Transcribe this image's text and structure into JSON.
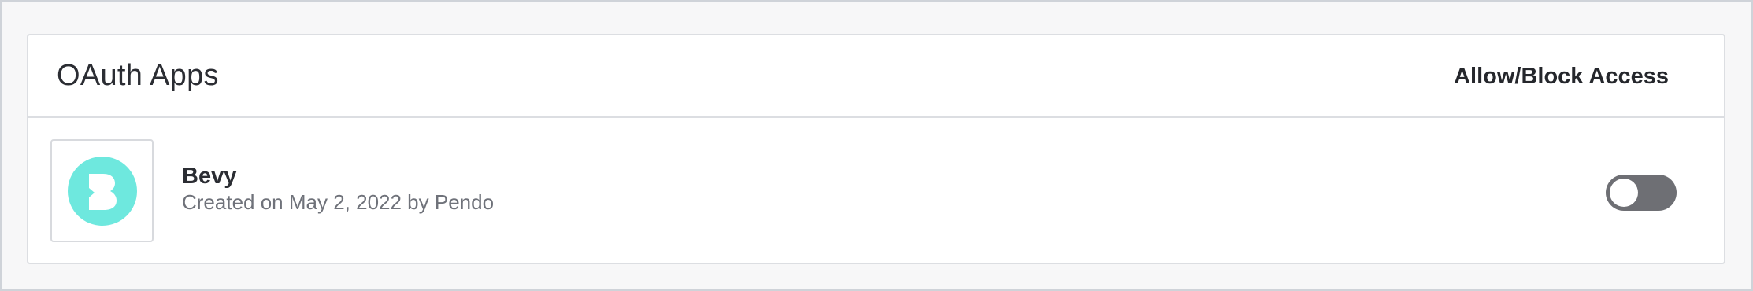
{
  "panel": {
    "title": "OAuth Apps",
    "header_action": "Allow/Block Access"
  },
  "apps": [
    {
      "name": "Bevy",
      "meta": "Created on May 2, 2022 by Pendo",
      "logo_icon": "bevy-logo-icon",
      "logo_color": "#6ee8de",
      "access_allowed": false,
      "toggle_color": "#6e6f74"
    }
  ]
}
